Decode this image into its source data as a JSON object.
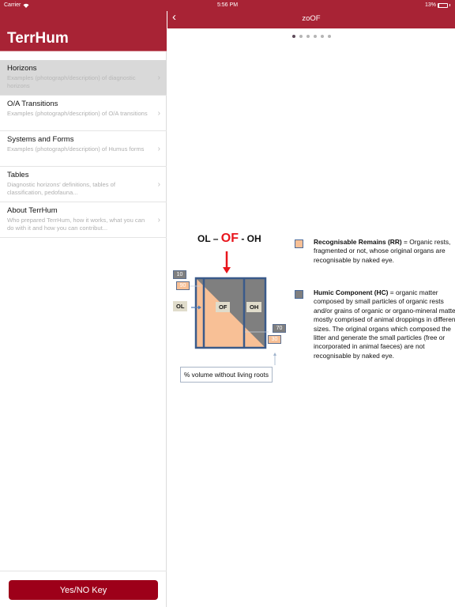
{
  "status_bar": {
    "carrier": "Carrier",
    "wifi_icon": "wifi-icon",
    "time": "5:56 PM",
    "battery_text": "13%",
    "battery_level": 0.13
  },
  "sidebar": {
    "title": "TerrHum",
    "items": [
      {
        "title": "Horizons",
        "subtitle": "Examples (photograph/description) of diagnostic horizons",
        "selected": true
      },
      {
        "title": "O/A Transitions",
        "subtitle": "Examples (photograph/description) of O/A transitions",
        "selected": false
      },
      {
        "title": "Systems and Forms",
        "subtitle": "Examples (photograph/description) of Humus forms",
        "selected": false
      },
      {
        "title": "Tables",
        "subtitle": "Diagnostic horizons' definitions, tables of classification, pedofauna...",
        "selected": false
      },
      {
        "title": "About TerrHum",
        "subtitle": "Who prepared TerrHum, how it works, what you can do with it and how you can contribut...",
        "selected": false
      }
    ],
    "chevron": "›",
    "footer_button": "Yes/NO Key"
  },
  "detail": {
    "back_icon": "‹",
    "title": "zoOF",
    "page_count": 6,
    "current_page": 1,
    "diagram": {
      "formula_left": "OL – ",
      "formula_highlight": "OF",
      "formula_right": " - OH",
      "labels": {
        "ol": "OL",
        "of": "OF",
        "oh": "OH"
      },
      "top_left_values": {
        "hc": "10",
        "rr": "90"
      },
      "bottom_right_values": {
        "hc": "70",
        "rr": "30"
      },
      "caption": "% volume without living roots",
      "colors": {
        "rr": "#f8c096",
        "hc": "#7f7f7f",
        "border": "#3a5a8a",
        "arrow": "#e8151c"
      },
      "legend": [
        {
          "term": "Recognisable Remains (RR)",
          "definition": " = Organic rests, fragmented or not, whose original organs are recognisable by naked  eye."
        },
        {
          "term": "Humic Component (HC)",
          "definition": " = organic matter composed by small particles of organic rests and/or grains of organic or organo-mineral matter mostly comprised of animal droppings in different sizes. The original organs which composed the litter and  generate the small particles (free or incorporated in animal faeces) are not recognisable by naked eye."
        }
      ]
    }
  }
}
